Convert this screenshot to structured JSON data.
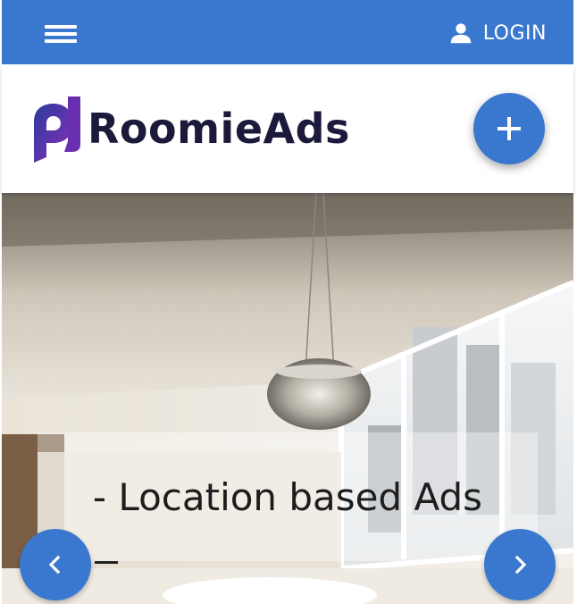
{
  "topbar": {
    "menu_icon": "hamburger-menu-icon",
    "login_label": "LOGIN",
    "login_icon": "user-icon",
    "color": "#3a78cf"
  },
  "header": {
    "logo_text": "RoomieAds",
    "add_button_icon": "plus-icon"
  },
  "slider": {
    "caption": "- Location based Ads",
    "prev_icon": "chevron-left-icon",
    "next_icon": "chevron-right-icon"
  }
}
